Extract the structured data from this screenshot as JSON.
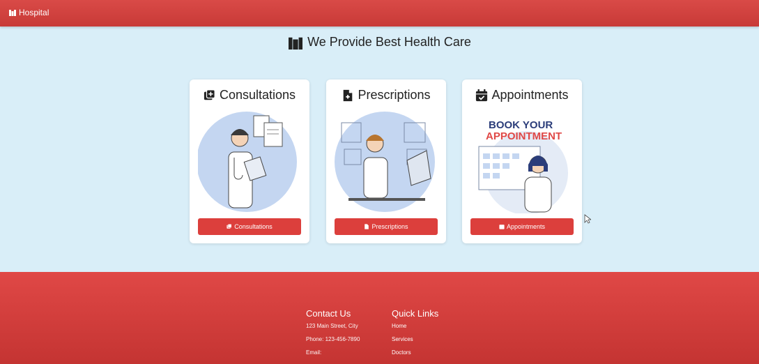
{
  "navbar": {
    "brand": "Hospital"
  },
  "hero": {
    "title": "We Provide Best Health Care"
  },
  "cards": [
    {
      "title": "Consultations",
      "button": "Consultations",
      "icon": "plus-square-icon"
    },
    {
      "title": "Prescriptions",
      "button": "Prescriptions",
      "icon": "file-medical-icon"
    },
    {
      "title": "Appointments",
      "button": "Appointments",
      "icon": "calendar-check-icon",
      "image_text": "BOOK YOUR APPOINTMENT"
    }
  ],
  "footer": {
    "contact": {
      "heading": "Contact Us",
      "address": "123 Main Street, City",
      "phone": "Phone: 123-456-7890",
      "email": "Email:"
    },
    "links": {
      "heading": "Quick Links",
      "items": [
        "Home",
        "Services",
        "Doctors"
      ]
    }
  },
  "colors": {
    "primary": "#dc3f3c",
    "background": "#d9eef8",
    "footer": "#e04846"
  }
}
